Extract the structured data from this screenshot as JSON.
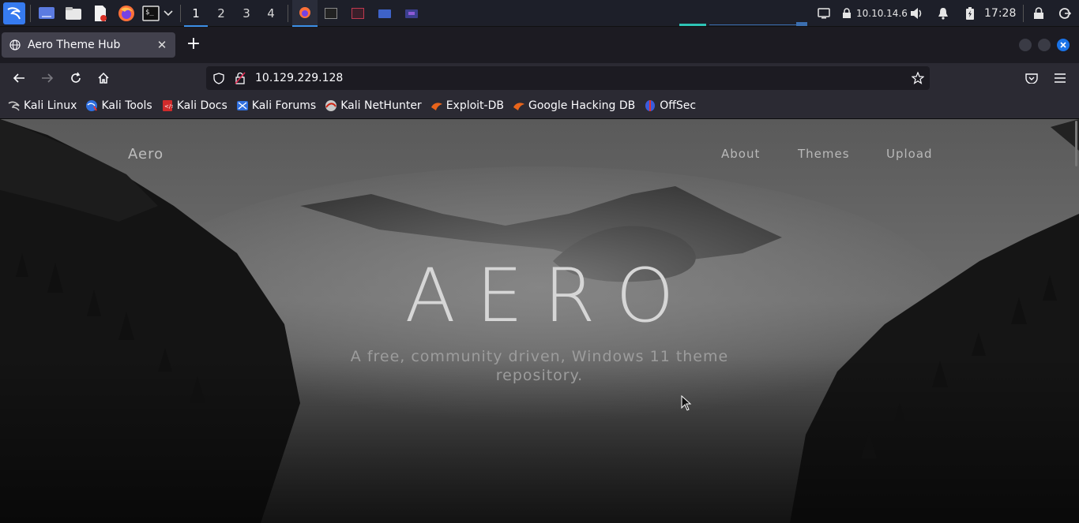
{
  "panel": {
    "workspaces": [
      "1",
      "2",
      "3",
      "4"
    ],
    "active_workspace": "1",
    "ip_address": "10.10.14.6",
    "clock": "17:28"
  },
  "browser": {
    "tab_title": "Aero Theme Hub",
    "url": "10.129.229.128"
  },
  "bookmarks": [
    {
      "label": "Kali Linux",
      "icon": "kali-icon"
    },
    {
      "label": "Kali Tools",
      "icon": "kali-tools-icon"
    },
    {
      "label": "Kali Docs",
      "icon": "kali-docs-icon"
    },
    {
      "label": "Kali Forums",
      "icon": "kali-forums-icon"
    },
    {
      "label": "Kali NetHunter",
      "icon": "nethunter-icon"
    },
    {
      "label": "Exploit-DB",
      "icon": "exploit-db-icon"
    },
    {
      "label": "Google Hacking DB",
      "icon": "ghdb-icon"
    },
    {
      "label": "OffSec",
      "icon": "offsec-icon"
    }
  ],
  "site": {
    "logo": "Aero",
    "nav": {
      "about": "About",
      "themes": "Themes",
      "upload": "Upload"
    },
    "hero_title": "AERO",
    "hero_subtitle": "A free, community driven, Windows 11 theme repository."
  },
  "colors": {
    "panel_bg": "#1d1f29",
    "browser_bg": "#2b2a33",
    "accent_blue": "#3b8fe6",
    "close_button": "#1a73e8"
  }
}
